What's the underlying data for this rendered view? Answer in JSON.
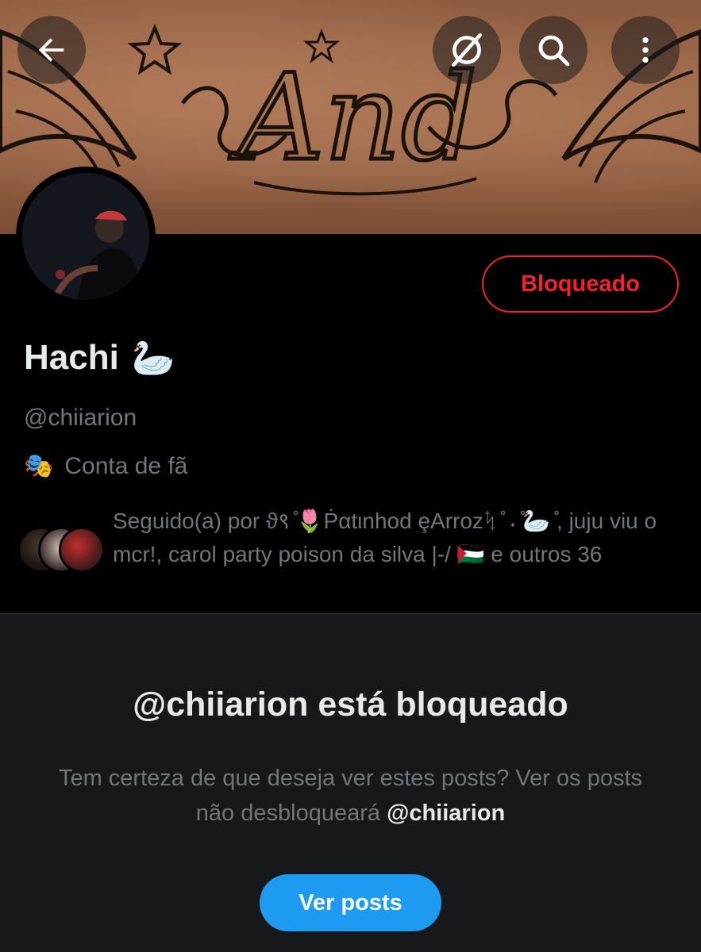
{
  "banner": {
    "tattoo_text": "And"
  },
  "top_actions": {
    "back_icon": "arrow-left-icon",
    "grok_icon": "grok-icon",
    "search_icon": "search-icon",
    "more_icon": "more-vertical-icon"
  },
  "profile": {
    "name": "Hachi",
    "name_emoji": "🦢",
    "handle": "@chiiarion",
    "category_icon": "🎭",
    "category": "Conta de fã",
    "blocked_button_label": "Bloqueado",
    "followers_text": "Seguido(a) por ϑ९ ̊🌷Ṗαtιnhod ȩArrozᛪ ̊ ˖ ̊🦢 ̊, juju viu o mcr!, carol party poison da silva |-/ 🇵🇸 e outros 36"
  },
  "blocked_notice": {
    "title": "@chiiarion está bloqueado",
    "desc_prefix": "Tem certeza de que deseja ver estes posts? Ver os posts não desbloqueará ",
    "desc_handle": "@chiiarion",
    "view_button_label": "Ver posts"
  },
  "colors": {
    "accent_blue": "#1d9bf0",
    "blocked_red": "#f4212e",
    "background": "#000000",
    "panel": "#16181c"
  }
}
